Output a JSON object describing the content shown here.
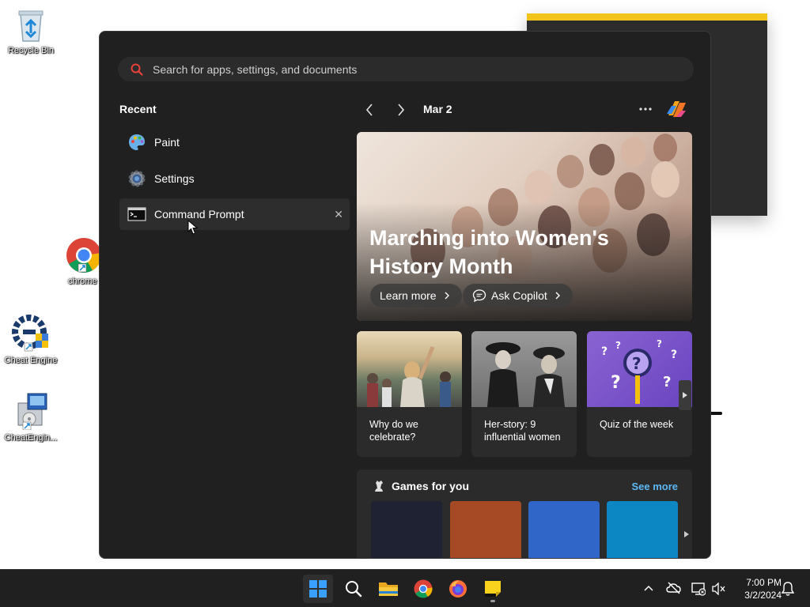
{
  "desktop": {
    "icons": [
      {
        "label": "Recycle Bin"
      },
      {
        "label": "chrome"
      },
      {
        "label": "Cheat Engine"
      },
      {
        "label": "CheatEngin..."
      }
    ]
  },
  "start_menu": {
    "search_placeholder": "Search for apps, settings, and documents",
    "recent_title": "Recent",
    "recent_items": [
      {
        "label": "Paint",
        "icon": "paint-icon"
      },
      {
        "label": "Settings",
        "icon": "gear-icon"
      },
      {
        "label": "Command Prompt",
        "icon": "terminal-icon"
      }
    ],
    "remove_symbol": "✕"
  },
  "widgets": {
    "date": "Mar 2",
    "hero": {
      "title": "Marching into Women's History Month",
      "learn_more": "Learn more",
      "ask_copilot": "Ask Copilot"
    },
    "cards": [
      {
        "caption": "Why do we celebrate?"
      },
      {
        "caption": "Her-story: 9 influential women"
      },
      {
        "caption": "Quiz of the week"
      }
    ],
    "games": {
      "title": "Games for you",
      "see_more": "See more",
      "tile_colors": [
        "#1e2233",
        "#a54a25",
        "#2f66c7",
        "#0d86c4"
      ]
    }
  },
  "taskbar": {
    "apps": [
      "start-icon",
      "search-icon",
      "file-explorer-icon",
      "chrome-icon",
      "firefox-icon",
      "sticky-notes-icon"
    ],
    "time": "7:00 PM",
    "date": "3/2/2024"
  },
  "colors": {
    "accent": "#0078d4",
    "link": "#5cb8f5",
    "menu_bg": "#202020",
    "taskbar_bg": "#202020"
  }
}
